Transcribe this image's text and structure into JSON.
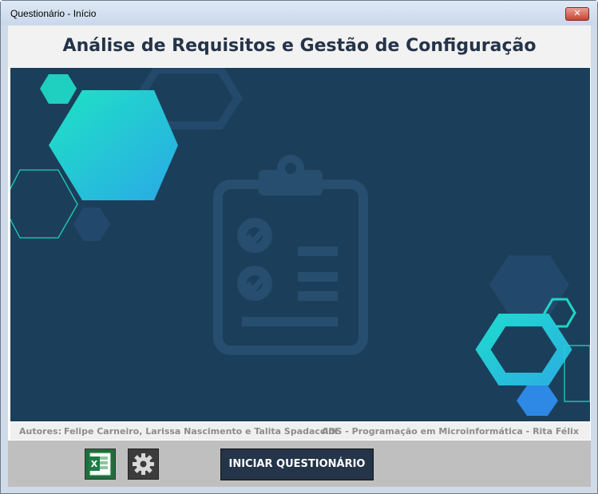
{
  "window": {
    "title": "Questionário - Início",
    "close_glyph": "✕"
  },
  "header": {
    "title": "Análise de Requisitos e Gestão de Configuração"
  },
  "authors": {
    "label": "Autores:",
    "names": "Felipe Carneiro, Larissa Nascimento e Talita Spadaccini",
    "course": "ADS - Programação em Microinformática - Rita Félix"
  },
  "footer": {
    "excel_icon": "excel-icon",
    "gear_icon": "gear-icon",
    "start_label": "INICIAR QUESTIONÁRIO"
  },
  "colors": {
    "hero_background": "#1b3f5a",
    "accent_teal": "#1fd6c8",
    "accent_blue": "#2d89e5",
    "navy": "#243449"
  }
}
